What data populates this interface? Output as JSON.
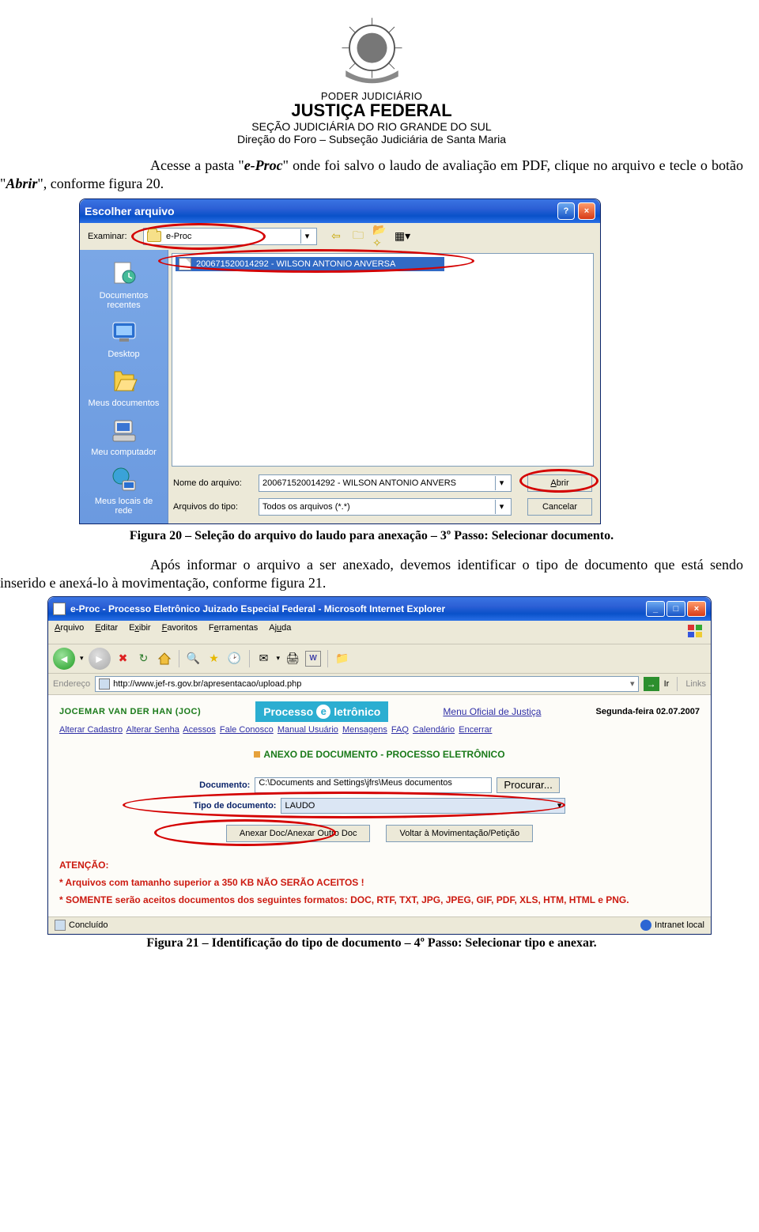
{
  "header": {
    "line1": "PODER JUDICIÁRIO",
    "line2": "JUSTIÇA FEDERAL",
    "line3": "SEÇÃO JUDICIÁRIA DO RIO GRANDE DO SUL",
    "line4": "Direção do Foro – Subseção Judiciária de Santa Maria"
  },
  "text": {
    "para1_a": "Acesse a pasta \"",
    "para1_b": "e-Proc",
    "para1_c": "\" onde foi salvo o laudo de avaliação em PDF, clique no arquivo e tecle o botão \"",
    "para1_d": "Abrir",
    "para1_e": "\", conforme figura 20.",
    "caption20": "Figura 20 – Seleção do arquivo do laudo para anexação – 3º Passo: Selecionar documento.",
    "para2": "Após informar o arquivo a ser anexado, devemos identificar o tipo de documento que está sendo inserido e anexá-lo à movimentação, conforme figura 21.",
    "caption21": "Figura 21 – Identificação do tipo de documento – 4º Passo: Selecionar tipo e anexar."
  },
  "dlg20": {
    "title": "Escolher arquivo",
    "examinar_label": "Examinar:",
    "folder": "e-Proc",
    "file_selected": "200671520014292 - WILSON ANTONIO ANVERSA",
    "toolbar": {
      "back": "⇦",
      "up": "🗀",
      "new": "📂✧",
      "views": "▦▾"
    },
    "places": [
      {
        "icon": "📄",
        "label": "Documentos recentes"
      },
      {
        "icon": "🖥",
        "label": "Desktop"
      },
      {
        "icon": "📁",
        "label": "Meus documentos"
      },
      {
        "icon": "💻",
        "label": "Meu computador"
      },
      {
        "icon": "🌐",
        "label": "Meus locais de rede"
      }
    ],
    "nome_label": "Nome do arquivo:",
    "nome_value": "200671520014292 - WILSON ANTONIO ANVERS",
    "tipo_label": "Arquivos do tipo:",
    "tipo_value": "Todos os arquivos (*.*)",
    "abrir": "Abrir",
    "cancelar": "Cancelar"
  },
  "ie": {
    "title": "e-Proc - Processo Eletrônico Juizado Especial Federal - Microsoft Internet Explorer",
    "menu": [
      "Arquivo",
      "Editar",
      "Exibir",
      "Favoritos",
      "Ferramentas",
      "Ajuda"
    ],
    "toolbar_icons": [
      "back",
      "fwd",
      "stop",
      "refresh",
      "home",
      "search",
      "favs",
      "history",
      "mail",
      "print",
      "word",
      "folder"
    ],
    "addr_label": "Endereço",
    "addr_url": "http://www.jef-rs.gov.br/apresentacao/upload.php",
    "go_label": "Ir",
    "links_label": "Links",
    "page": {
      "user": "JOCEMAR VAN DER HAN (JOC)",
      "logo_a": "Processo",
      "logo_b": "letrônico",
      "menu_oficial": "Menu Oficial de Justiça",
      "date": "Segunda-feira 02.07.2007",
      "nav": [
        "Alterar Cadastro",
        "Alterar Senha",
        "Acessos",
        "Fale Conosco",
        "Manual Usuário",
        "Mensagens",
        "FAQ",
        "Calendário"
      ],
      "nav_encerrar": "Encerrar",
      "section_title": "ANEXO DE DOCUMENTO - PROCESSO ELETRÔNICO",
      "doc_label": "Documento:",
      "doc_value": "C:\\Documents and Settings\\jfrs\\Meus documentos",
      "procurar": "Procurar...",
      "tipo_label": "Tipo de documento:",
      "tipo_value": "LAUDO",
      "btn_anexar": "Anexar Doc/Anexar Outro Doc",
      "btn_voltar": "Voltar à Movimentação/Petição",
      "atencao": "ATENÇÃO:",
      "note1": "* Arquivos com tamanho superior a 350 KB NÃO SERÃO ACEITOS !",
      "note2": "* SOMENTE serão aceitos documentos dos seguintes formatos: DOC, RTF, TXT, JPG, JPEG, GIF, PDF, XLS, HTM, HTML e PNG."
    },
    "status_left": "Concluído",
    "status_right": "Intranet local"
  }
}
